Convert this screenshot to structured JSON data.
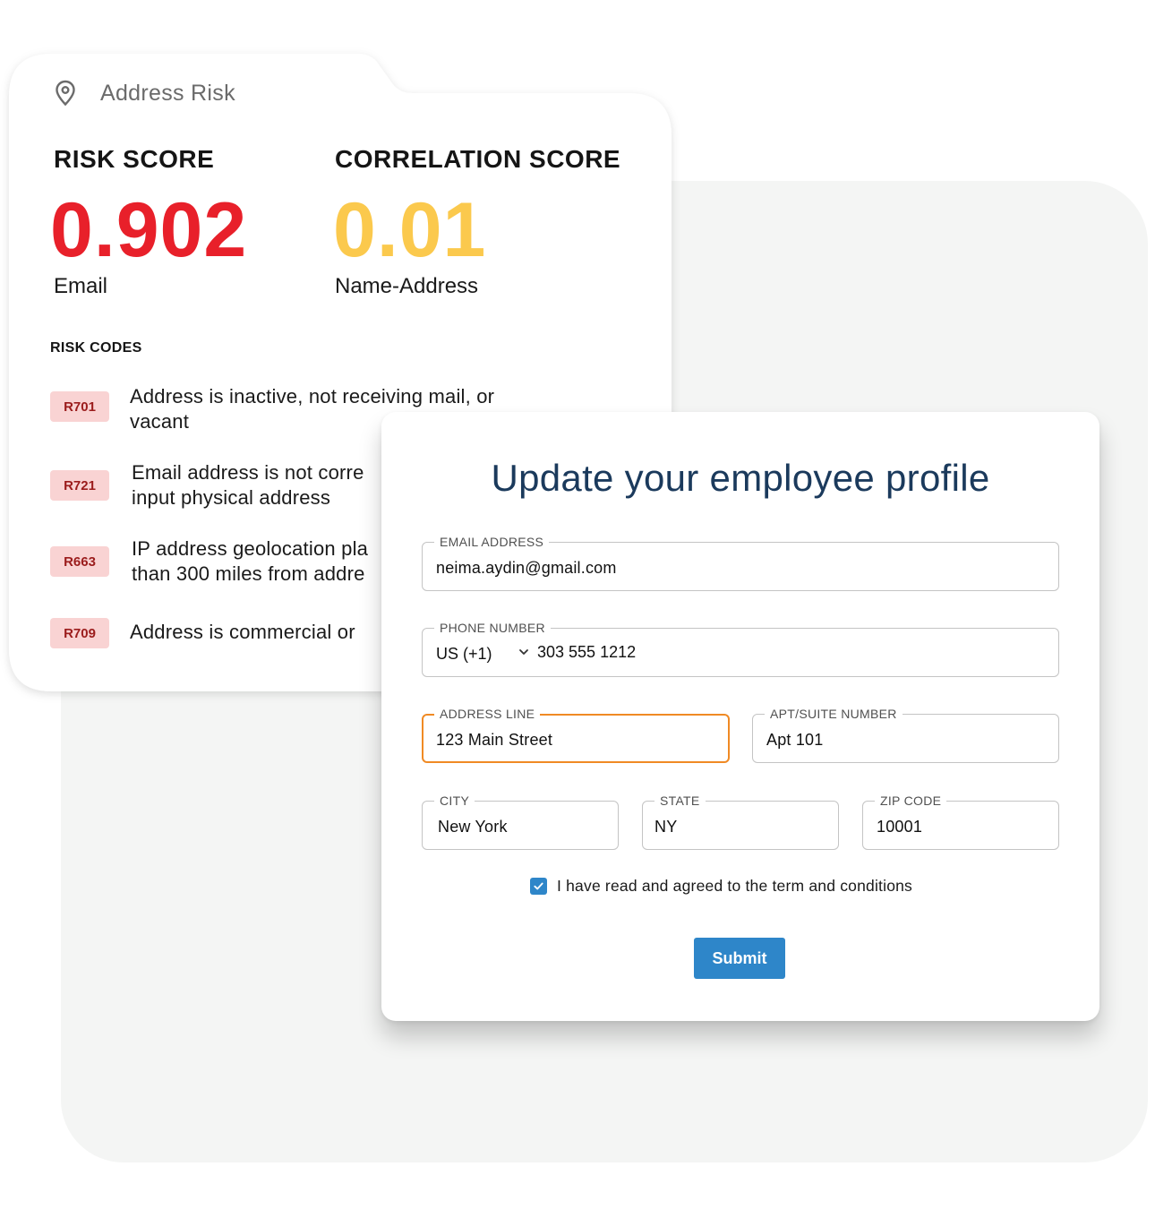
{
  "risk_card": {
    "title": "Address Risk",
    "risk_score": {
      "label": "RISK SCORE",
      "value": "0.902",
      "sub": "Email",
      "color": "#e8202a"
    },
    "correlation_score": {
      "label": "CORRELATION SCORE",
      "value": "0.01",
      "sub": "Name-Address",
      "color": "#fbc94d"
    },
    "risk_codes_heading": "RISK CODES",
    "codes": [
      {
        "code": "R701",
        "line1": "Address is inactive, not receiving mail, or",
        "line2": "vacant"
      },
      {
        "code": "R721",
        "line1": "Email address is not corre",
        "line2": "input physical address"
      },
      {
        "code": "R663",
        "line1": "IP address geolocation pla",
        "line2": "than 300 miles from addre"
      },
      {
        "code": "R709",
        "line1": "Address is commercial or",
        "line2": ""
      }
    ]
  },
  "form": {
    "title": "Update your employee profile",
    "email": {
      "label": "EMAIL ADDRESS",
      "value": "neima.aydin@gmail.com"
    },
    "phone": {
      "label": "PHONE NUMBER",
      "country": "US (+1)",
      "value": "303 555 1212"
    },
    "address": {
      "label": "ADDRESS LINE",
      "value": "123 Main Street"
    },
    "apt": {
      "label": "APT/SUITE NUMBER",
      "value": "Apt 101"
    },
    "city": {
      "label": "CITY",
      "value": "New York"
    },
    "state": {
      "label": "STATE",
      "value": "NY"
    },
    "zip": {
      "label": "ZIP CODE",
      "value": "10001"
    },
    "agree_text": "I have read and agreed to the term and conditions",
    "agree_checked": true,
    "submit_label": "Submit",
    "accent_color": "#2e86c9",
    "focus_color": "#f08a24"
  }
}
